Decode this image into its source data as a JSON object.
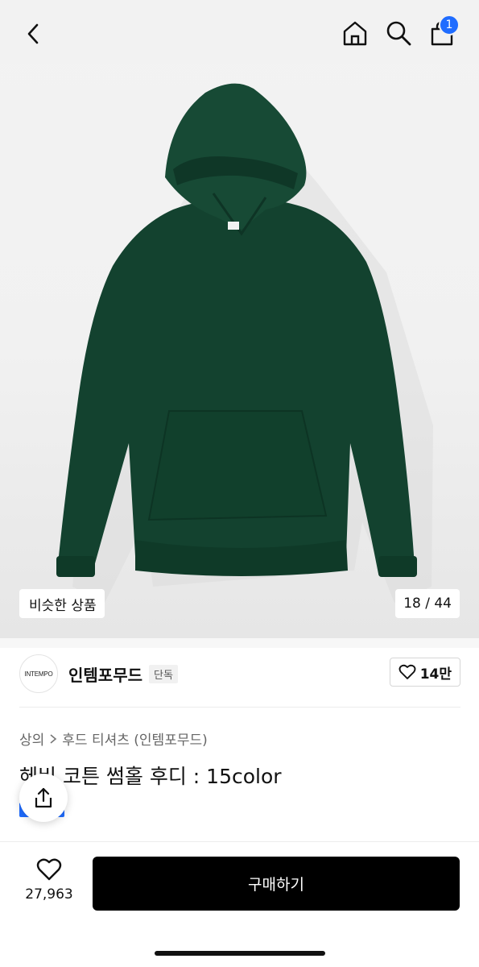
{
  "header": {
    "icons": [
      "chevron-left-icon",
      "home-icon",
      "search-icon",
      "shopping-bag-icon"
    ],
    "cart_badge": "1",
    "accent_color": "#1f6cff"
  },
  "gallery": {
    "similar_label": "비슷한 상품",
    "counter": "18 / 44",
    "product_color": "#13422f"
  },
  "brand": {
    "logo_text": "INTEMPO",
    "name": "인템포무드",
    "tag": "단독",
    "likes": "14만"
  },
  "product": {
    "breadcrumb": [
      "상의",
      "후드 티셔츠 (인템포무드)"
    ],
    "title": "헤비 코튼 썸홀 후디 : 15color"
  },
  "bottom": {
    "wish_count": "27,963",
    "buy_label": "구매하기"
  }
}
